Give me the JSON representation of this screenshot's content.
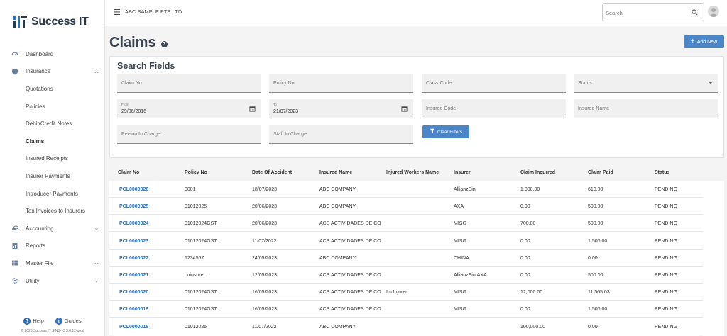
{
  "app": {
    "name": "Success IT",
    "company": "ABC SAMPLE PTE LTD"
  },
  "search": {
    "placeholder": "Search"
  },
  "sidebar": {
    "items": [
      {
        "label": "Dashboard",
        "icon": "dashboard-icon"
      },
      {
        "label": "Insurance",
        "icon": "shield-icon",
        "expanded": true
      },
      {
        "label": "Quotations"
      },
      {
        "label": "Policies"
      },
      {
        "label": "Debit/Credit Notes"
      },
      {
        "label": "Claims",
        "active": true
      },
      {
        "label": "Insured Receipts"
      },
      {
        "label": "Insurer Payments"
      },
      {
        "label": "Introducer Payments"
      },
      {
        "label": "Tax Invoices to Insurers"
      },
      {
        "label": "Accounting",
        "icon": "coins-icon"
      },
      {
        "label": "Reports",
        "icon": "report-icon"
      },
      {
        "label": "Master File",
        "icon": "table-icon"
      },
      {
        "label": "Utility",
        "icon": "gear-icon"
      }
    ],
    "help_label": "Help",
    "guides_label": "Guides",
    "copyright": "© 2023 Success IT SINS-v3 3.6.12-prod"
  },
  "page": {
    "title": "Claims",
    "add_new_label": "Add New"
  },
  "search_fields": {
    "title": "Search Fields",
    "claim_no": "Claim No",
    "policy_no": "Policy No",
    "class_code": "Class Code",
    "status": "Status",
    "from_label": "From",
    "from_value": "29/06/2016",
    "to_label": "To",
    "to_value": "21/07/2023",
    "insured_code": "Insured Code",
    "insured_name": "Insured Name",
    "person_in_charge": "Person In Charge",
    "staff_in_charge": "Staff In Charge",
    "clear_filters_label": "Clear Filters"
  },
  "table": {
    "headers": [
      "Claim No",
      "Policy No",
      "Date Of Accident",
      "Insured Name",
      "Injured Workers Name",
      "Insurer",
      "Claim Incurred",
      "Claim Paid",
      "Status"
    ],
    "rows": [
      [
        "PCL0000026",
        "0001",
        "18/07/2023",
        "ABC COMPANY",
        "",
        "AllianzSin",
        "1,000.00",
        "610.00",
        "PENDING"
      ],
      [
        "PCL0000025",
        "01012025",
        "20/06/2023",
        "ABC COMPANY",
        "",
        "AXA",
        "0.00",
        "500.00",
        "PENDING"
      ],
      [
        "PCL0000024",
        "01012024GST",
        "20/06/2023",
        "ACS ACTIVIDADES DE CO",
        "",
        "MISG",
        "700.00",
        "500.00",
        "PENDING"
      ],
      [
        "PCL0000023",
        "01012024GST",
        "11/07/2022",
        "ACS ACTIVIDADES DE CO",
        "",
        "MISG",
        "0.00",
        "1,500.00",
        "PENDING"
      ],
      [
        "PCL0000022",
        "1234567",
        "24/05/2023",
        "ABC COMPANY",
        "",
        "CHINA",
        "0.00",
        "0.00",
        "PENDING"
      ],
      [
        "PCL0000021",
        "coinsurer",
        "12/05/2023",
        "ACS ACTIVIDADES DE CO",
        "",
        "AllianzSin,AXA",
        "0.00",
        "500.00",
        "PENDING"
      ],
      [
        "PCL0000020",
        "01012024GST",
        "16/05/2023",
        "ACS ACTIVIDADES DE CO",
        "Im Injured",
        "MISG",
        "12,000.00",
        "11,565.03",
        "PENDING"
      ],
      [
        "PCL0000019",
        "01012024GST",
        "16/05/2023",
        "ACS ACTIVIDADES DE CO",
        "",
        "MISG",
        "0.00",
        "1,500.00",
        "PENDING"
      ],
      [
        "PCL0000018",
        "01012025",
        "11/07/2022",
        "ABC COMPANY",
        "",
        "",
        "100,000.00",
        "0.00",
        "PENDING"
      ]
    ]
  },
  "colors": {
    "primary": "#4a86c8",
    "link": "#2e6fb7",
    "title": "#3a4450"
  }
}
